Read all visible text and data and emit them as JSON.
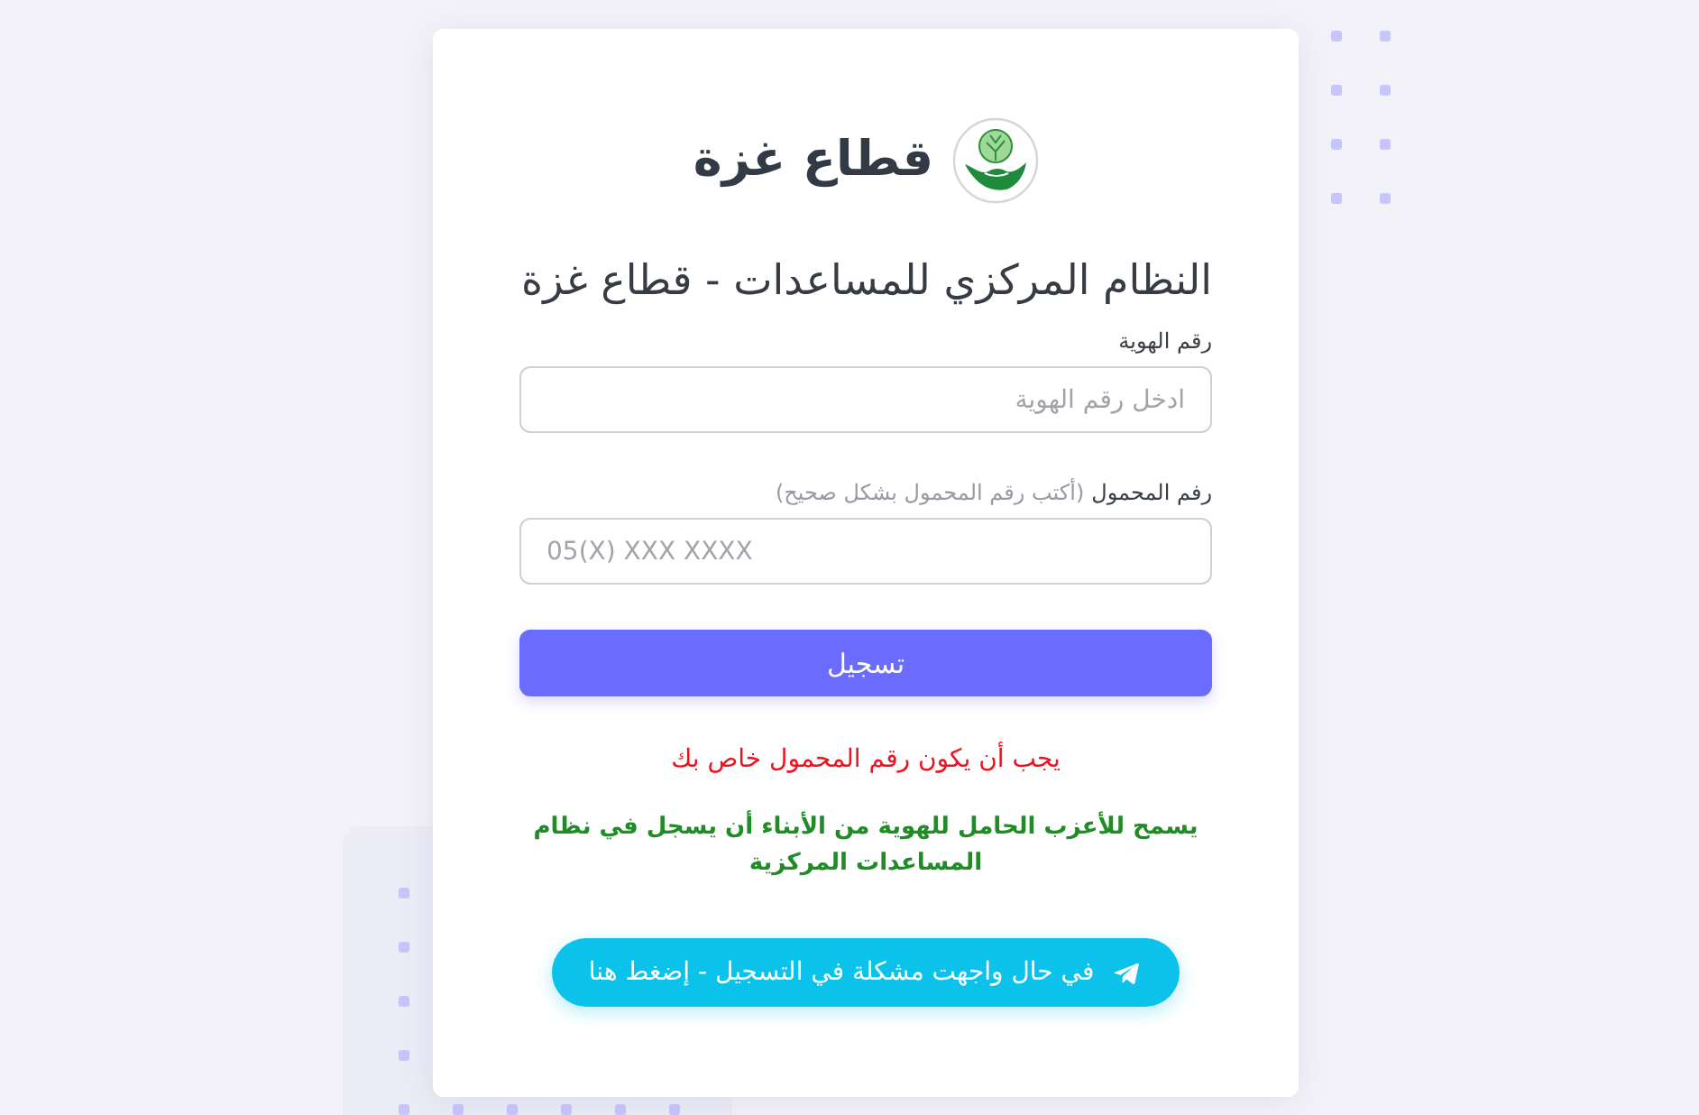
{
  "brand": {
    "title": "قطاع غزة"
  },
  "heading": "النظام المركزي للمساعدات - قطاع غزة",
  "fields": [
    {
      "kind": "text",
      "label": "رقم الهوية",
      "placeholder": "ادخل رقم الهوية"
    },
    {
      "kind": "phone",
      "label": "رفم المحمول",
      "hint": "(أكتب رقم المحمول بشكل صحيح)",
      "placeholder": "05(X) XXX XXXX"
    }
  ],
  "submit_button": "تسجيل",
  "messages": [
    {
      "kind": "warning",
      "text": "يجب أن يكون رقم المحمول خاص بك"
    },
    {
      "kind": "note",
      "text": "يسمح للأعزب الحامل للهوية من الأبناء أن يسجل في نظام المساعدات المركزية"
    }
  ],
  "help_button": "في حال واجهت مشكلة في التسجيل - إضغط هنا"
}
